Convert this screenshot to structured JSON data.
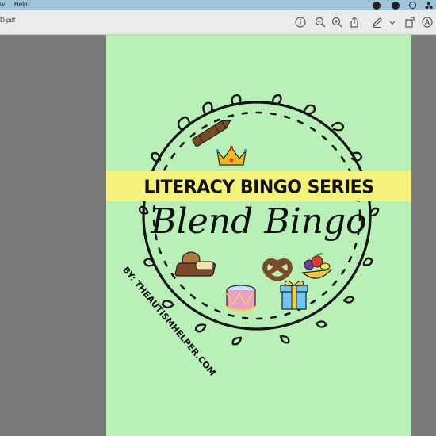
{
  "menubar": {
    "items": [
      "w",
      "Help"
    ]
  },
  "toolbar": {
    "document_title": "D.pdf",
    "icons": [
      "info-icon",
      "zoom-out-icon",
      "zoom-in-icon",
      "share-icon",
      "markup-pen-icon",
      "chevron-down-icon",
      "rotate-icon",
      "annotate-icon"
    ]
  },
  "page": {
    "banner_text": "LITERACY BINGO SERIES",
    "title": "Blend Bingo",
    "author": "BY: THEAUTISMHELPER.COM",
    "background_color": "#b8f0b8",
    "banner_color": "#f4f27a",
    "pictures": [
      "crayon",
      "crown",
      "bread",
      "pretzel",
      "fruit",
      "drum",
      "gift"
    ]
  }
}
